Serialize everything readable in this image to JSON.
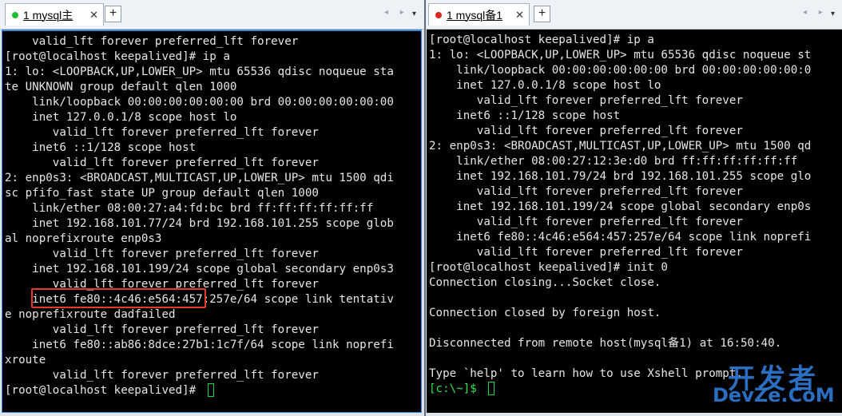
{
  "colors": {
    "terminal_bg": "#000000",
    "terminal_text": "#e6e6e6",
    "prompt_green": "#2ee54a",
    "active_tab_dot": "#1fbf2f",
    "inactive_tab_dot": "#d9261c",
    "highlight_box": "#e23a2e",
    "watermark": "#2f7ad6"
  },
  "icons": {
    "add_tab": "plus-icon",
    "close_tab": "close-icon",
    "nav": "chevron-left-right-icon",
    "menu": "chevron-down-icon"
  },
  "left_session": {
    "tab_label": "1 mysql主",
    "close_symbol": "✕",
    "add_symbol": "+",
    "nav_symbol": "◂ ▸",
    "menu_symbol": "▾",
    "lines": [
      "    valid_lft forever preferred_lft forever",
      "[root@localhost keepalived]# ip a",
      "1: lo: <LOOPBACK,UP,LOWER_UP> mtu 65536 qdisc noqueue sta",
      "te UNKNOWN group default qlen 1000",
      "    link/loopback 00:00:00:00:00:00 brd 00:00:00:00:00:00",
      "    inet 127.0.0.1/8 scope host lo",
      "       valid_lft forever preferred_lft forever",
      "    inet6 ::1/128 scope host",
      "       valid_lft forever preferred_lft forever",
      "2: enp0s3: <BROADCAST,MULTICAST,UP,LOWER_UP> mtu 1500 qdi",
      "sc pfifo_fast state UP group default qlen 1000",
      "    link/ether 08:00:27:a4:fd:bc brd ff:ff:ff:ff:ff:ff",
      "    inet 192.168.101.77/24 brd 192.168.101.255 scope glob",
      "al noprefixroute enp0s3",
      "       valid_lft forever preferred_lft forever",
      "    inet 192.168.101.199/24 scope global secondary enp0s3",
      "       valid_lft forever preferred_lft forever",
      "    inet6 fe80::4c46:e564:457:257e/64 scope link tentativ",
      "e noprefixroute dadfailed",
      "       valid_lft forever preferred_lft forever",
      "    inet6 fe80::ab86:8dce:27b1:1c7f/64 scope link noprefi",
      "xroute",
      "       valid_lft forever preferred_lft forever"
    ],
    "prompt": "[root@localhost keepalived]# "
  },
  "right_session": {
    "tab_label": "1 mysql备1",
    "close_symbol": "✕",
    "add_symbol": "+",
    "nav_symbol": "◂ ▸",
    "menu_symbol": "▾",
    "lines": [
      "[root@localhost keepalived]# ip a",
      "1: lo: <LOOPBACK,UP,LOWER_UP> mtu 65536 qdisc noqueue st",
      "    link/loopback 00:00:00:00:00:00 brd 00:00:00:00:00:0",
      "    inet 127.0.0.1/8 scope host lo",
      "       valid_lft forever preferred_lft forever",
      "    inet6 ::1/128 scope host",
      "       valid_lft forever preferred_lft forever",
      "2: enp0s3: <BROADCAST,MULTICAST,UP,LOWER_UP> mtu 1500 qd",
      "    link/ether 08:00:27:12:3e:d0 brd ff:ff:ff:ff:ff:ff",
      "    inet 192.168.101.79/24 brd 192.168.101.255 scope glo",
      "       valid_lft forever preferred_lft forever",
      "    inet 192.168.101.199/24 scope global secondary enp0s",
      "       valid_lft forever preferred_lft forever",
      "    inet6 fe80::4c46:e564:457:257e/64 scope link noprefi",
      "       valid_lft forever preferred_lft forever",
      "[root@localhost keepalived]# init 0",
      "Connection closing...Socket close.",
      "",
      "Connection closed by foreign host.",
      "",
      "Disconnected from remote host(mysql备1) at 16:50:40.",
      "",
      "Type `help' to learn how to use Xshell prompt."
    ],
    "prompt": "[c:\\~]$ "
  },
  "watermark": {
    "top": "开发者",
    "bottom": "DevZe.CoM"
  }
}
